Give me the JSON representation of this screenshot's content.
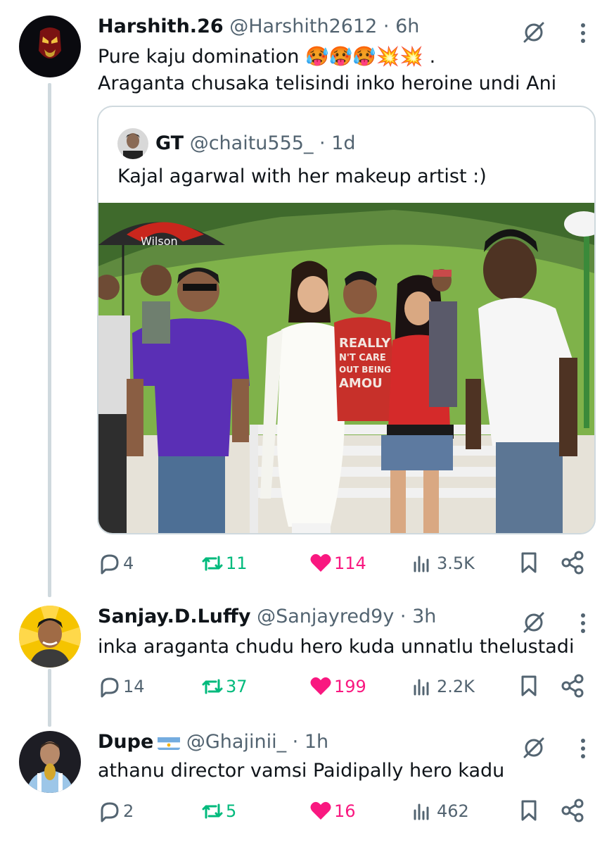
{
  "tweets": [
    {
      "name": "Harshith.26",
      "handle": "@Harshith2612",
      "time": "6h",
      "line1": "Pure kaju domination 🥵🥵🥵💥💥 .",
      "line2": "Araganta chusaka telisindi inko heroine undi Ani",
      "replies": "4",
      "reposts": "11",
      "likes": "114",
      "views": "3.5K",
      "quote": {
        "name": "GT",
        "handle": "@chaitu555_",
        "time": "1d",
        "text": "Kajal agarwal with her makeup artist :)",
        "photo_overlay": {
          "umbrella": "Wilson",
          "shirt_line1": "REALLY",
          "shirt_line2": "N'T CARE",
          "shirt_line3": "OUT BEING",
          "shirt_line4": "AMOU"
        }
      }
    },
    {
      "name": "Sanjay.D.Luffy",
      "handle": "@Sanjayred9y",
      "time": "3h",
      "text": "inka araganta chudu hero kuda unnatlu thelustadi",
      "replies": "14",
      "reposts": "37",
      "likes": "199",
      "views": "2.2K"
    },
    {
      "name": "Dupe",
      "handle": "@Ghajinii_",
      "time": "1h",
      "text": "athanu director vamsi Paidipally hero kadu",
      "replies": "2",
      "reposts": "5",
      "likes": "16",
      "views": "462"
    }
  ],
  "dot": "·",
  "icons": [
    "reply-icon",
    "repost-icon",
    "like-icon",
    "views-icon",
    "bookmark-icon",
    "share-icon",
    "grok-icon",
    "more-icon"
  ],
  "colors": {
    "repost": "#00ba7c",
    "like": "#f91880",
    "secondary": "#536471",
    "line": "#cfd9de"
  }
}
